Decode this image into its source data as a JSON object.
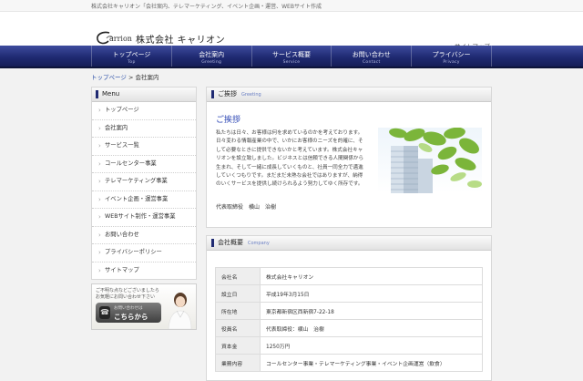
{
  "topbar": {
    "tagline": "株式会社キャリオン「会社案内、テレマーケティング、イベント企画・運営、WEBサイト作成"
  },
  "header": {
    "logo_en": "arrion",
    "logo_jp": "株式会社 キャリオン",
    "sitemap": "サイトマップ"
  },
  "nav": [
    {
      "jp": "トップページ",
      "en": "Top"
    },
    {
      "jp": "会社案内",
      "en": "Greeting"
    },
    {
      "jp": "サービス概要",
      "en": "Service"
    },
    {
      "jp": "お問い合わせ",
      "en": "Contact"
    },
    {
      "jp": "プライバシー",
      "en": "Privacy"
    }
  ],
  "breadcrumb": {
    "home": "トップページ",
    "sep": " > ",
    "current": "会社案内"
  },
  "sidebar": {
    "title": "Menu",
    "items": [
      "トップページ",
      "会社案内",
      "サービス一覧",
      "コールセンター事業",
      "テレマーケティング事業",
      "イベント企画・運営事業",
      "WEBサイト制作・運営事業",
      "お問い合わせ",
      "プライバシーポリシー",
      "サイトマップ"
    ],
    "banner": {
      "line1": "ご不明な点などございましたら",
      "line2": "お気軽にお問い合わせ下さい",
      "btn_small": "お問い合わせは",
      "btn_big": "こちらから"
    }
  },
  "greeting": {
    "title": "ご挨拶",
    "title_en": "Greeting",
    "heading": "ご挨拶",
    "body": "私たちは日々、お客様は何を求めているのかを考えております。日々変わる情報産業の中で、いかにお客様のニーズを的確に、そして必要なときに提供できないかと考えています。株式会社キャリオンを設立致しました。ビジネスとは信頼できる人間関係から生まれ、そして一緒に成長していくものと、社員一同全力で邁進していくつもりです。まだまだ未熟な会社ではありますが、納得のいくサービスを提供し続けられるよう努力してゆく所存です。",
    "signature": "代表取締役　横山　治樹"
  },
  "company": {
    "title": "会社概要",
    "title_en": "Company",
    "rows": [
      {
        "k": "会社名",
        "v": "株式会社キャリオン"
      },
      {
        "k": "設立日",
        "v": "平成19年3月15日"
      },
      {
        "k": "所在地",
        "v": "東京都新宿区西新宿7-22-18"
      },
      {
        "k": "役員名",
        "v": "代表取締役：横山　治樹"
      },
      {
        "k": "資本金",
        "v": "1250万円"
      },
      {
        "k": "業務内容",
        "v": "コールセンター事業・テレマーケティング事業・イベント企画運営（飲食）"
      }
    ]
  },
  "colors": {
    "nav": "#1f2a72",
    "heading": "#2c46b4",
    "link": "#2a4ea8"
  }
}
